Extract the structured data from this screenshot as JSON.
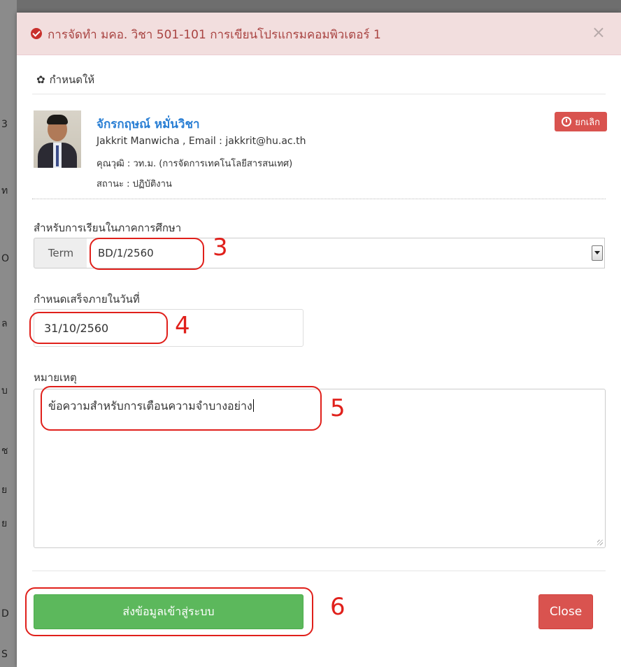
{
  "background": {
    "edge_glyphs": [
      "3",
      "ท",
      "O",
      "ล",
      "บ",
      "ช",
      "ย",
      "ย",
      "D",
      "S"
    ]
  },
  "alert": {
    "title": "การจัดทำ มคอ. วิชา 501-101 การเขียนโปรแกรมคอมพิวเตอร์ 1",
    "close_symbol": "×"
  },
  "assign": {
    "heading": "กำหนดให้"
  },
  "user": {
    "name": "จักรกฤษณ์ หมั่นวิชา",
    "line1": "Jakkrit Manwicha , Email : jakkrit@hu.ac.th",
    "line2": "คุณวุฒิ : วท.ม. (การจัดการเทคโนโลยีสารสนเทศ)",
    "line3": "สถานะ : ปฏิบัติงาน",
    "cancel_label": "ยกเลิก"
  },
  "form": {
    "term_label": "สำหรับการเรียนในภาคการศึกษา",
    "term_addon": "Term",
    "term_value": "BD/1/2560",
    "due_label": "กำหนดเสร็จภายในวันที่",
    "due_value": "31/10/2560",
    "note_label": "หมายเหตุ",
    "note_value": "ข้อความสำหรับการเตือนความจำบางอย่าง"
  },
  "actions": {
    "submit_label": "ส่งข้อมูลเข้าสู่ระบบ",
    "close_label": "Close"
  },
  "annotations": [
    "3",
    "4",
    "5",
    "6"
  ],
  "colors": {
    "alert_bg": "#f2dede",
    "alert_text": "#a94442",
    "danger": "#d9534f",
    "success": "#5cb85c",
    "link": "#2a7fd4",
    "annotation": "#e0201b"
  }
}
